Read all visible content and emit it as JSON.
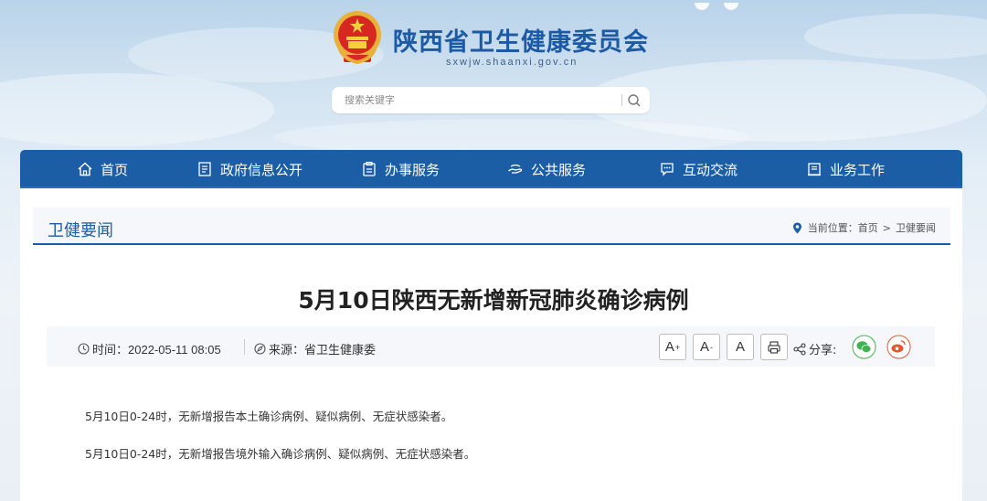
{
  "site": {
    "title": "陕西省卫生健康委员会",
    "domain": "sxwjw.shaanxi.gov.cn"
  },
  "search": {
    "placeholder": "搜索关键字"
  },
  "nav": {
    "items": [
      {
        "label": "首页",
        "icon": "home-icon"
      },
      {
        "label": "政府信息公开",
        "icon": "document-icon"
      },
      {
        "label": "办事服务",
        "icon": "clipboard-icon"
      },
      {
        "label": "公共服务",
        "icon": "hands-icon"
      },
      {
        "label": "互动交流",
        "icon": "chat-icon"
      },
      {
        "label": "业务工作",
        "icon": "folder-icon"
      }
    ]
  },
  "section": {
    "title": "卫健要闻",
    "breadcrumb_label": "当前位置：",
    "breadcrumb": [
      "首页",
      "卫健要闻"
    ]
  },
  "article": {
    "headline": "5月10日陕西无新增新冠肺炎确诊病例",
    "time": "时间：2022-05-11 08:05",
    "source": "来源：省卫生健康委",
    "font_large": "A",
    "font_medium": "A",
    "font_small": "A",
    "share_label": "分享:",
    "paragraphs": [
      "5月10日0-24时，无新增报告本土确诊病例、疑似病例、无症状感染者。",
      "5月10日0-24时，无新增报告境外输入确诊病例、疑似病例、无症状感染者。"
    ]
  },
  "colors": {
    "nav_bg": "#1c5ea6",
    "title_blue": "#1c5aa6",
    "wechat": "#3fb34f",
    "weibo": "#e8552c"
  }
}
